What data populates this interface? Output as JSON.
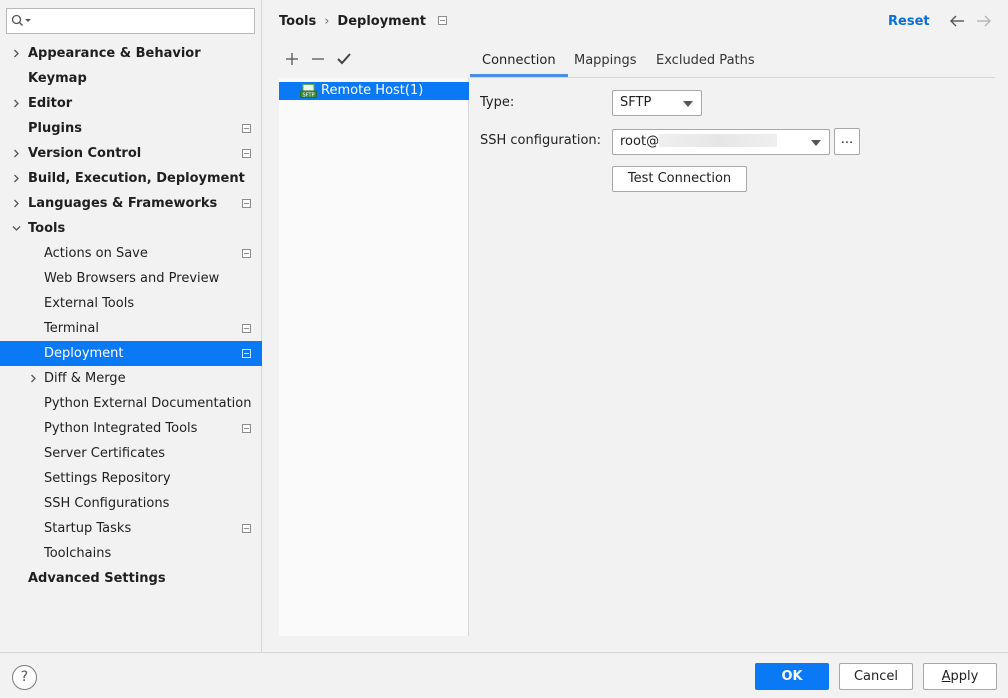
{
  "search": {
    "placeholder": ""
  },
  "sidebar": {
    "items": [
      {
        "label": "Appearance & Behavior",
        "level": 0,
        "expandable": true
      },
      {
        "label": "Keymap",
        "level": 0,
        "expandable": false
      },
      {
        "label": "Editor",
        "level": 0,
        "expandable": true
      },
      {
        "label": "Plugins",
        "level": 0,
        "expandable": false,
        "project": true
      },
      {
        "label": "Version Control",
        "level": 0,
        "expandable": true,
        "project": true
      },
      {
        "label": "Build, Execution, Deployment",
        "level": 0,
        "expandable": true
      },
      {
        "label": "Languages & Frameworks",
        "level": 0,
        "expandable": true,
        "project": true
      },
      {
        "label": "Tools",
        "level": 0,
        "expandable": true,
        "expanded": true
      },
      {
        "label": "Actions on Save",
        "level": 1,
        "project": true
      },
      {
        "label": "Web Browsers and Preview",
        "level": 1
      },
      {
        "label": "External Tools",
        "level": 1
      },
      {
        "label": "Terminal",
        "level": 1,
        "project": true
      },
      {
        "label": "Deployment",
        "level": 1,
        "project": true,
        "selected": true
      },
      {
        "label": "Diff & Merge",
        "level": 1,
        "expandable": true
      },
      {
        "label": "Python External Documentation",
        "level": 1
      },
      {
        "label": "Python Integrated Tools",
        "level": 1,
        "project": true
      },
      {
        "label": "Server Certificates",
        "level": 1
      },
      {
        "label": "Settings Repository",
        "level": 1
      },
      {
        "label": "SSH Configurations",
        "level": 1
      },
      {
        "label": "Startup Tasks",
        "level": 1,
        "project": true
      },
      {
        "label": "Toolchains",
        "level": 1
      },
      {
        "label": "Advanced Settings",
        "level": 0,
        "expandable": false
      }
    ]
  },
  "header": {
    "breadcrumb_parent": "Tools",
    "breadcrumb_separator": "›",
    "breadcrumb_current": "Deployment",
    "reset_label": "Reset"
  },
  "servers": {
    "items": [
      {
        "label": "Remote Host(1)",
        "selected": true
      }
    ]
  },
  "tabs": [
    {
      "label": "Connection",
      "active": true
    },
    {
      "label": "Mappings",
      "active": false
    },
    {
      "label": "Excluded Paths",
      "active": false
    }
  ],
  "form": {
    "type_label": "Type:",
    "type_value": "SFTP",
    "ssh_label": "SSH configuration:",
    "ssh_value": "root@",
    "browse_label": "...",
    "test_connection_label": "Test Connection"
  },
  "footer": {
    "help_label": "?",
    "ok_label": "OK",
    "cancel_label": "Cancel",
    "apply_label": "Apply"
  },
  "colors": {
    "accent": "#0a79f6",
    "link": "#0a6fd6",
    "background": "#f2f2f2"
  }
}
